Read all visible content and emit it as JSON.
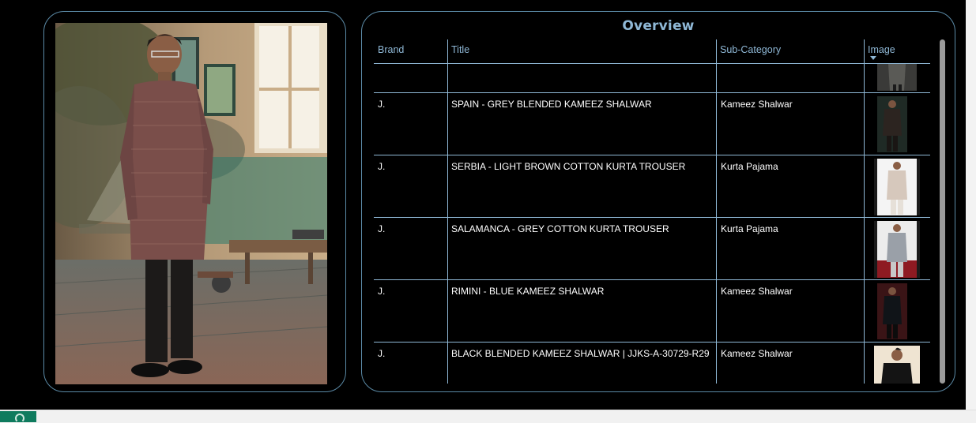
{
  "overview": {
    "title": "Overview",
    "columns": [
      "Brand",
      "Title",
      "Sub-Category",
      "Image"
    ],
    "rows": [
      {
        "brand": "",
        "title": "",
        "sub_category": "",
        "image": "partial-kurta-thumbnail"
      },
      {
        "brand": "J.",
        "title": "SPAIN - GREY BLENDED KAMEEZ SHALWAR",
        "sub_category": "Kameez Shalwar",
        "image": "dark-kameez-thumbnail"
      },
      {
        "brand": "J.",
        "title": "SERBIA - LIGHT BROWN COTTON KURTA TROUSER",
        "sub_category": "Kurta Pajama",
        "image": "light-kurta-thumbnail"
      },
      {
        "brand": "J.",
        "title": "SALAMANCA - GREY COTTON KURTA TROUSER",
        "sub_category": "Kurta Pajama",
        "image": "grey-kurta-thumbnail"
      },
      {
        "brand": "J.",
        "title": "RIMINI - BLUE KAMEEZ SHALWAR",
        "sub_category": "Kameez Shalwar",
        "image": "blue-kameez-thumbnail"
      },
      {
        "brand": "J.",
        "title": "BLACK BLENDED KAMEEZ SHALWAR | JJKS-A-30729-R29",
        "sub_category": "Kameez Shalwar",
        "image": "black-kameez-thumbnail"
      }
    ]
  },
  "colors": {
    "background": "#000000",
    "accent": "#8fb8d6",
    "border": "#5b8aa6",
    "text": "#ffffff",
    "page_tab": "#0f7b5e"
  }
}
